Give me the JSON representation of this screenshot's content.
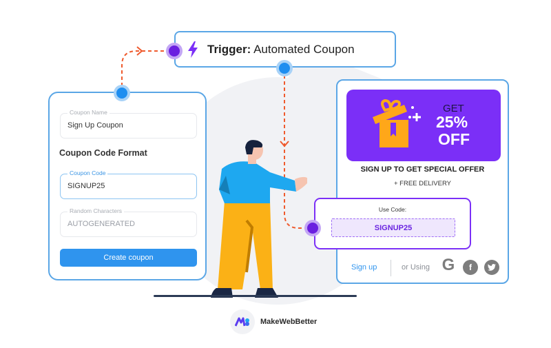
{
  "trigger": {
    "label_bold": "Trigger:",
    "label_rest": " Automated Coupon",
    "icon": "lightning-bolt-icon"
  },
  "form": {
    "coupon_name": {
      "legend": "Coupon Name",
      "value": "Sign Up Coupon"
    },
    "section_title": "Coupon Code Format",
    "coupon_code": {
      "legend": "Coupon Code",
      "value": "SIGNUP25"
    },
    "random_characters": {
      "legend": "Random Characters",
      "value": "AUTOGENERATED"
    },
    "create_button": "Create coupon"
  },
  "offer": {
    "banner": {
      "get": "GET",
      "percent": "25%",
      "off": "OFF",
      "icon": "gift-box-icon"
    },
    "headline": "SIGN UP TO GET SPECIAL OFFER",
    "subline": "+ FREE DELIVERY",
    "use_code_label": "Use Code:",
    "code": "SIGNUP25",
    "signup_link": "Sign up",
    "or_using": "or Using",
    "social": [
      {
        "name": "google",
        "glyph": "G"
      },
      {
        "name": "facebook",
        "glyph": "f"
      },
      {
        "name": "twitter",
        "glyph": "t"
      }
    ]
  },
  "brand": {
    "name": "MakeWebBetter"
  },
  "colors": {
    "accent_blue": "#2f94ee",
    "card_border": "#5aa6e6",
    "purple": "#7b2ff7",
    "connector": "#ef5a2d",
    "gift": "#ffa719"
  }
}
